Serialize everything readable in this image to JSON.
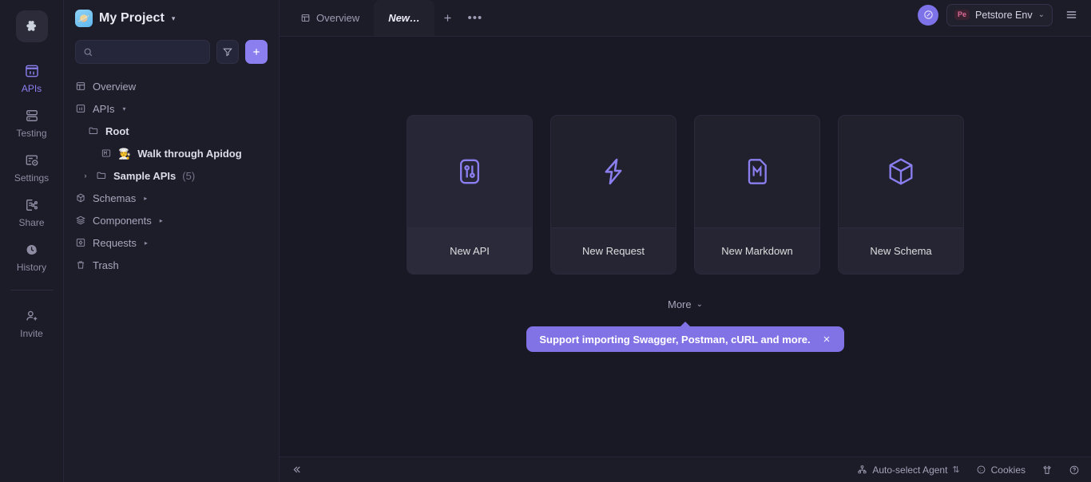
{
  "rail": {
    "logo_name": "apidog-logo",
    "items": [
      {
        "label": "APIs",
        "icon": "apis-icon",
        "active": true
      },
      {
        "label": "Testing",
        "icon": "testing-icon",
        "active": false
      },
      {
        "label": "Settings",
        "icon": "settings-icon",
        "active": false
      },
      {
        "label": "Share",
        "icon": "share-icon",
        "active": false
      },
      {
        "label": "History",
        "icon": "history-icon",
        "active": false
      }
    ],
    "bottom": {
      "label": "Invite",
      "icon": "invite-icon"
    }
  },
  "sidebar": {
    "project_name": "My Project",
    "project_emoji": "🪐",
    "project_caret": "▾",
    "search": {
      "value": "",
      "placeholder": ""
    },
    "filter_button": "filter-icon",
    "add_button": "+",
    "tree": [
      {
        "label": "Overview",
        "icon": "overview-icon",
        "indent": 0,
        "bold": false,
        "caret": "",
        "chevron": "",
        "count": ""
      },
      {
        "label": "APIs",
        "icon": "apis-icon",
        "indent": 0,
        "bold": false,
        "caret": "▾",
        "chevron": "",
        "count": ""
      },
      {
        "label": "Root",
        "icon": "folder-icon",
        "indent": 1,
        "bold": true,
        "caret": "",
        "chevron": "",
        "count": ""
      },
      {
        "label": "Walk through Apidog",
        "icon": "markdown-icon",
        "emoji": "🧑‍🍳",
        "indent": 2,
        "bold": true,
        "caret": "",
        "chevron": "",
        "count": ""
      },
      {
        "label": "Sample APIs",
        "icon": "folder-icon",
        "indent": 1,
        "bold": true,
        "caret": "",
        "chevron": "›",
        "count": "(5)"
      },
      {
        "label": "Schemas",
        "icon": "schemas-icon",
        "indent": 0,
        "bold": false,
        "caret": "▸",
        "chevron": "",
        "count": ""
      },
      {
        "label": "Components",
        "icon": "components-icon",
        "indent": 0,
        "bold": false,
        "caret": "▸",
        "chevron": "",
        "count": ""
      },
      {
        "label": "Requests",
        "icon": "requests-icon",
        "indent": 0,
        "bold": false,
        "caret": "▸",
        "chevron": "",
        "count": ""
      },
      {
        "label": "Trash",
        "icon": "trash-icon",
        "indent": 0,
        "bold": false,
        "caret": "",
        "chevron": "",
        "count": ""
      }
    ]
  },
  "tabs": {
    "items": [
      {
        "label": "Overview",
        "icon": "overview-icon",
        "active": false
      },
      {
        "label": "New…",
        "icon": "",
        "active": true
      }
    ],
    "add_tab": "+",
    "more_tabs": "•••"
  },
  "topbar": {
    "assistant_button": "compass-icon",
    "env_badge": "Pe",
    "env_name": "Petstore Env",
    "env_caret": "⌄",
    "menu_button": "hamburger-icon"
  },
  "cards": [
    {
      "label": "New API",
      "icon": "api-icon",
      "hovered": true
    },
    {
      "label": "New Request",
      "icon": "lightning-icon",
      "hovered": false
    },
    {
      "label": "New Markdown",
      "icon": "markdown-file-icon",
      "hovered": false
    },
    {
      "label": "New Schema",
      "icon": "cube-icon",
      "hovered": false
    }
  ],
  "more": {
    "label": "More",
    "caret": "⌄"
  },
  "tooltip": {
    "text": "Support importing Swagger, Postman, cURL and more.",
    "close": "×"
  },
  "statusbar": {
    "collapse": "«",
    "agent": {
      "label": "Auto-select Agent",
      "icon": "agent-icon",
      "caret": "⇅"
    },
    "cookies": {
      "label": "Cookies",
      "icon": "cookie-icon"
    },
    "theme_icon": "tshirt-icon",
    "help_icon": "help-icon"
  },
  "colors": {
    "accent": "#8b7ff0",
    "app_bg": "#191926",
    "panel_bg": "#1d1d29",
    "card_bg": "#21212e",
    "tooltip_bg": "#8173e6"
  }
}
